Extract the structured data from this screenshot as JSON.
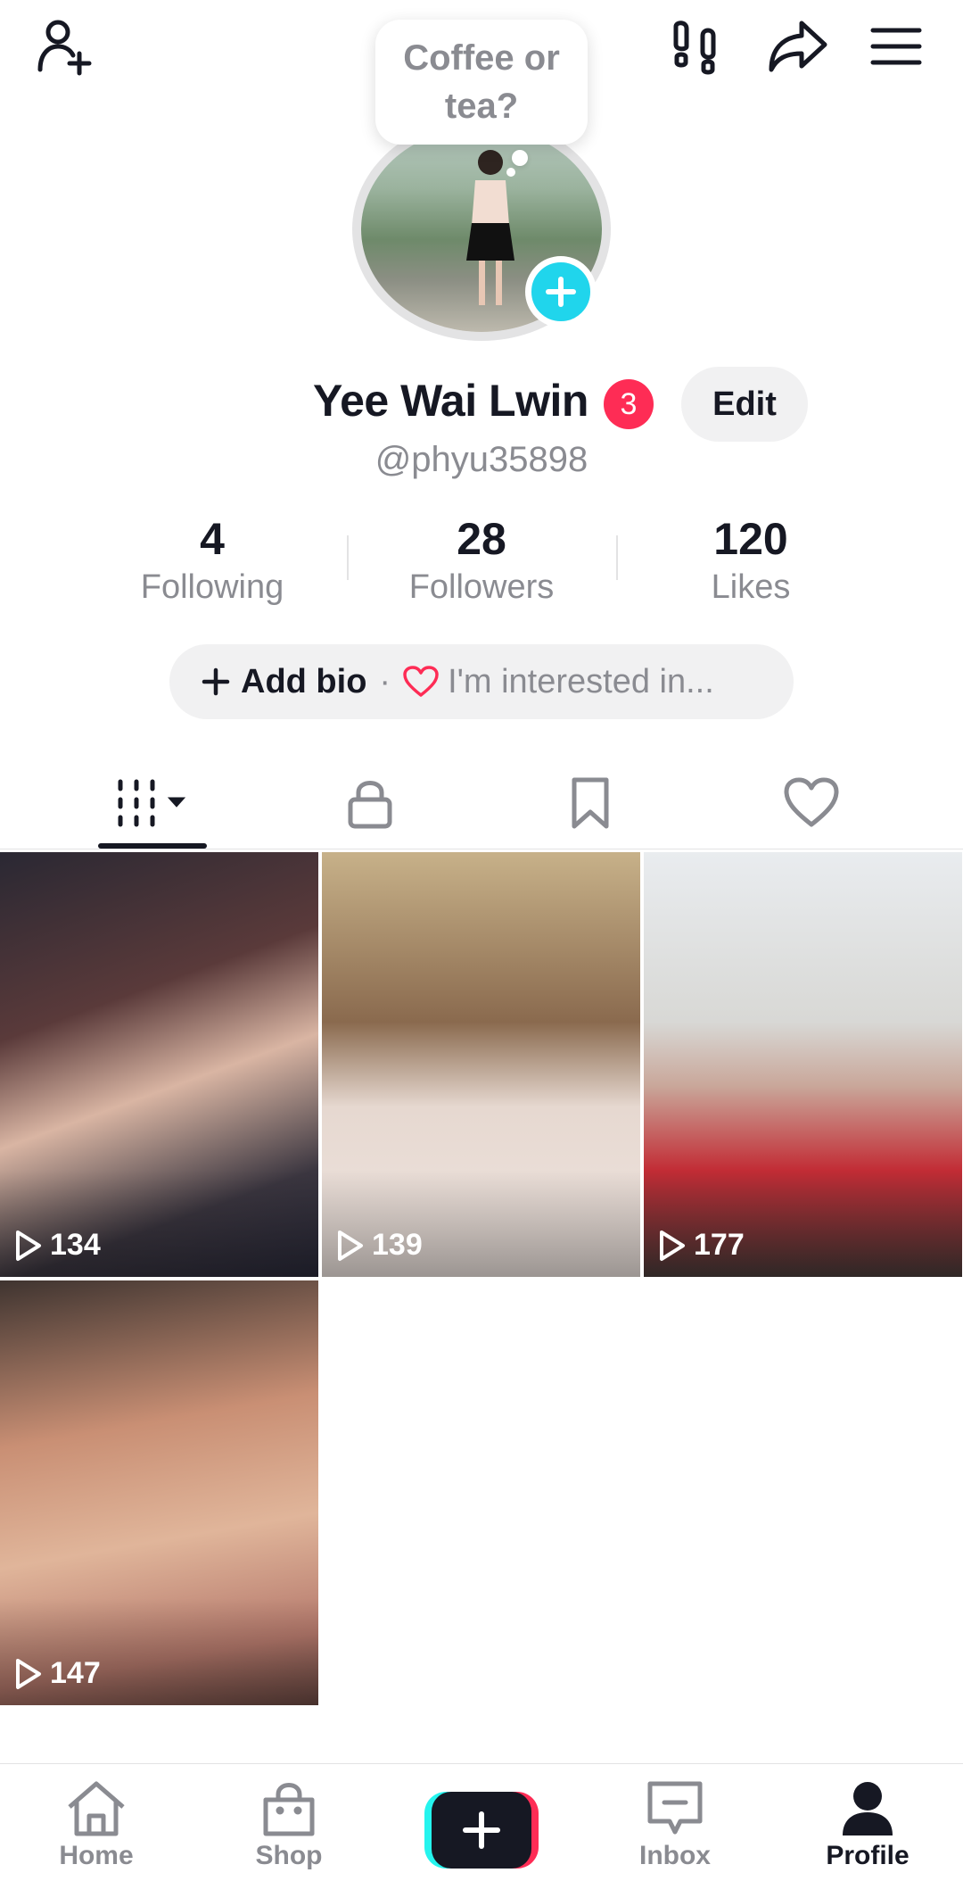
{
  "header": {
    "add_friend_icon": "person-plus-icon",
    "footprint_icon": "footprints-icon",
    "share_icon": "share-arrow-icon",
    "menu_icon": "hamburger-menu-icon"
  },
  "profile": {
    "bubble_text": "Coffee or tea?",
    "display_name": "Yee Wai Lwin",
    "notification_count": "3",
    "edit_label": "Edit",
    "username": "@phyu35898"
  },
  "stats": {
    "following": {
      "value": "4",
      "label": "Following"
    },
    "followers": {
      "value": "28",
      "label": "Followers"
    },
    "likes": {
      "value": "120",
      "label": "Likes"
    }
  },
  "bio": {
    "add_label": "Add bio",
    "separator": "·",
    "interest_label": "I'm interested in..."
  },
  "tabs": [
    {
      "name": "videos",
      "icon": "video-grid-icon"
    },
    {
      "name": "private",
      "icon": "lock-icon"
    },
    {
      "name": "saved",
      "icon": "bookmark-icon"
    },
    {
      "name": "liked",
      "icon": "heart-icon"
    }
  ],
  "videos": [
    {
      "views": "134"
    },
    {
      "views": "139"
    },
    {
      "views": "177"
    },
    {
      "views": "147"
    }
  ],
  "bottom_nav": {
    "home": "Home",
    "shop": "Shop",
    "inbox": "Inbox",
    "profile": "Profile"
  },
  "colors": {
    "accent_pink": "#fe2c55",
    "accent_cyan": "#20d5ec",
    "text_primary": "#161823",
    "text_secondary": "#8a8b91"
  }
}
